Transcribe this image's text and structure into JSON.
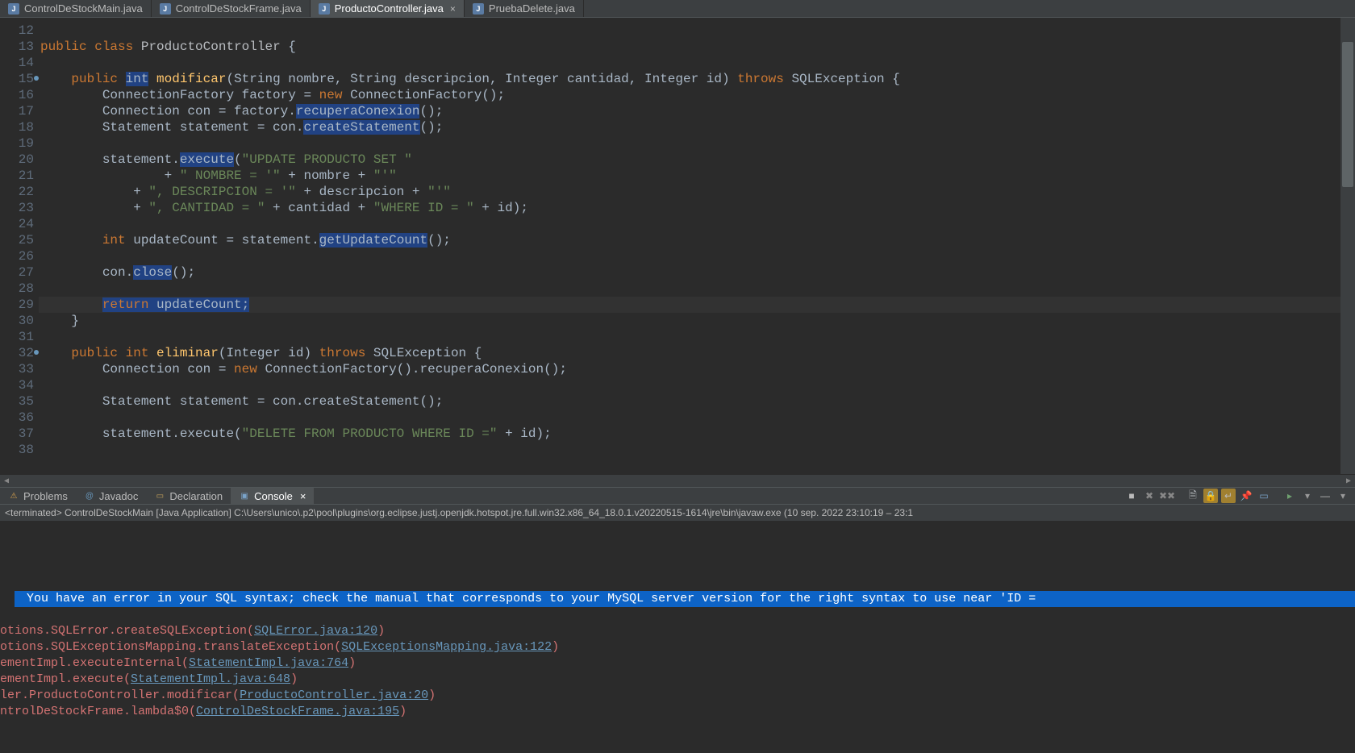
{
  "tabs": [
    {
      "label": "ControlDeStockMain.java",
      "active": false
    },
    {
      "label": "ControlDeStockFrame.java",
      "active": false
    },
    {
      "label": "ProductoController.java",
      "active": true
    },
    {
      "label": "PruebaDelete.java",
      "active": false
    }
  ],
  "gutter": {
    "start": 12,
    "end": 38,
    "markers": [
      15,
      32
    ]
  },
  "code_tokens": {
    "l13_public": "public",
    "l13_class": "class",
    "l13_name": "ProductoController",
    "l13_brace": " {",
    "l15_public": "public",
    "l15_int": "int",
    "l15_mname": "modificar",
    "l15_p1t": "String",
    "l15_p1n": "nombre",
    "l15_p2t": "String",
    "l15_p2n": "descripcion",
    "l15_p3t": "Integer",
    "l15_p3n": "cantidad",
    "l15_p4t": "Integer",
    "l15_p4n": "id",
    "l15_throws": "throws",
    "l15_exc": "SQLException",
    "l16_a": "ConnectionFactory",
    "l16_b": "factory",
    "l16_new": "new",
    "l16_c": "ConnectionFactory",
    "l17_a": "Connection",
    "l17_b": "con",
    "l17_c": "factory",
    "l17_m": "recuperaConexion",
    "l18_a": "Statement",
    "l18_b": "statement",
    "l18_c": "con",
    "l18_m": "createStatement",
    "l20_a": "statement",
    "l20_m": "execute",
    "l20_s": "\"UPDATE PRODUCTO SET \"",
    "l21_s1": "\" NOMBRE = '\"",
    "l21_v": "nombre",
    "l21_s2": "\"'\"",
    "l22_s1": "\", DESCRIPCION = '\"",
    "l22_v": "descripcion",
    "l22_s2": "\"'\"",
    "l23_s1": "\", CANTIDAD = \"",
    "l23_v": "cantidad",
    "l23_s2": "\"WHERE ID = \"",
    "l23_v2": "id",
    "l25_t": "int",
    "l25_v": "updateCount",
    "l25_o": "statement",
    "l25_m": "getUpdateCount",
    "l27_o": "con",
    "l27_m": "close",
    "l29_r": "return",
    "l29_v": "updateCount;",
    "l30_c": "}",
    "l32_public": "public",
    "l32_int": "int",
    "l32_mname": "eliminar",
    "l32_pt": "Integer",
    "l32_pn": "id",
    "l32_throws": "throws",
    "l32_exc": "SQLException",
    "l33_t": "Connection",
    "l33_v": "con",
    "l33_new": "new",
    "l33_c": "ConnectionFactory",
    "l33_m": "recuperaConexion",
    "l35_t": "Statement",
    "l35_v": "statement",
    "l35_o": "con",
    "l35_m": "createStatement",
    "l37_o": "statement",
    "l37_m": "execute",
    "l37_s": "\"DELETE FROM PRODUCTO WHERE ID =\"",
    "l37_v": "id"
  },
  "bottom_tabs": [
    {
      "label": "Problems",
      "icon": "⚠",
      "active": false
    },
    {
      "label": "Javadoc",
      "icon": "@",
      "active": false
    },
    {
      "label": "Declaration",
      "icon": "📄",
      "active": false
    },
    {
      "label": "Console",
      "icon": "▣",
      "active": true
    }
  ],
  "console": {
    "header": "<terminated> ControlDeStockMain [Java Application] C:\\Users\\unico\\.p2\\pool\\plugins\\org.eclipse.justj.openjdk.hotspot.jre.full.win32.x86_64_18.0.1.v20220515-1614\\jre\\bin\\javaw.exe  (10 sep. 2022 23:10:19 – 23:1",
    "highlight": " You have an error in your SQL syntax; check the manual that corresponds to your MySQL server version for the right syntax to use near 'ID =",
    "lines": [
      {
        "pre": "otions.SQLError.createSQLException(",
        "link": "SQLError.java:120",
        "post": ")"
      },
      {
        "pre": "otions.SQLExceptionsMapping.translateException(",
        "link": "SQLExceptionsMapping.java:122",
        "post": ")"
      },
      {
        "pre": "ementImpl.executeInternal(",
        "link": "StatementImpl.java:764",
        "post": ")"
      },
      {
        "pre": "ementImpl.execute(",
        "link": "StatementImpl.java:648",
        "post": ")"
      },
      {
        "pre": "ler.ProductoController.modificar(",
        "link": "ProductoController.java:20",
        "post": ")"
      },
      {
        "pre": "ntrolDeStockFrame.lambda$0(",
        "link": "ControlDeStockFrame.java:195",
        "post": ")"
      }
    ]
  }
}
